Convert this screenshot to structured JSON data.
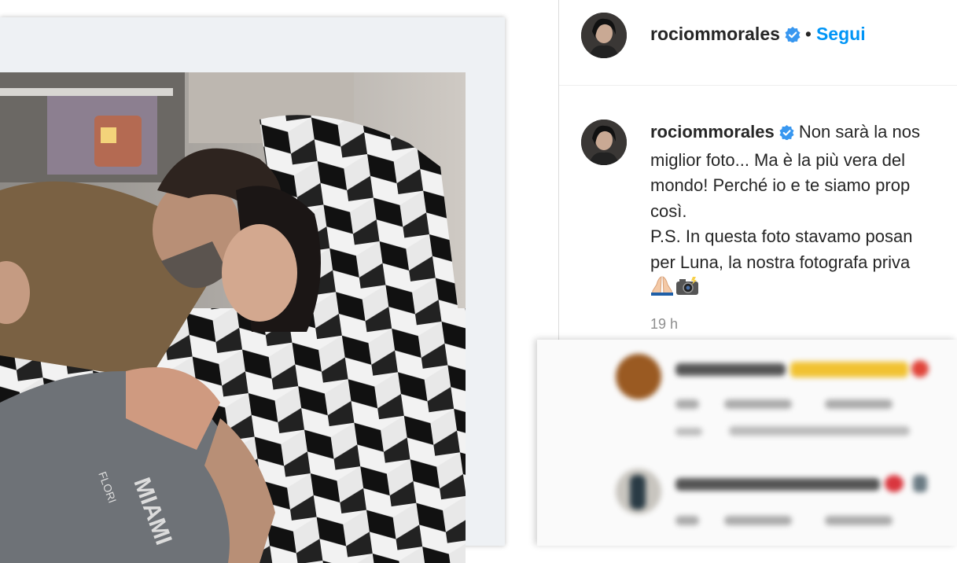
{
  "post": {
    "username": "rociommorales",
    "separator": "•",
    "follow_label": "Segui",
    "caption": {
      "username": "rociommorales",
      "text_1": "Non sarà la nostra miglior foto... Ma è la più vera del mondo! Perché io e te siamo proprio così.",
      "line_1": "Non sarà la nos",
      "line_2": "miglior foto... Ma è la più vera del",
      "line_3": "mondo! Perché io e te siamo prop",
      "line_4": "così.",
      "line_5": "P.S. In questa foto stavamo posan",
      "line_6": "per Luna, la nostra fotografa priva"
    },
    "timestamp": "19 h"
  },
  "photo": {
    "shirt_text": "MIAMI",
    "shirt_subtext": "FLORI"
  },
  "icons": {
    "verified": "verified-badge-icon",
    "praying_hands": "praying-hands-emoji",
    "camera": "camera-with-flash-emoji"
  },
  "colors": {
    "follow": "#0095f6",
    "verified": "#3897f0",
    "text": "#262626",
    "muted": "#8e8e8e"
  }
}
